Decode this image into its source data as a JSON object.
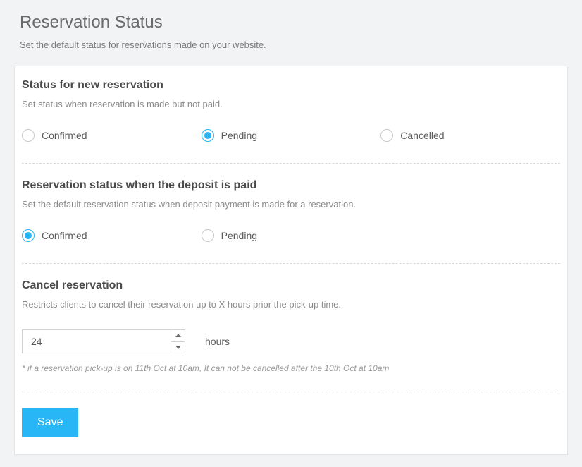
{
  "header": {
    "title": "Reservation Status",
    "subtitle": "Set the default status for reservations made on your website."
  },
  "section1": {
    "title": "Status for new reservation",
    "desc": "Set status when reservation is made but not paid.",
    "options": {
      "confirmed": "Confirmed",
      "pending": "Pending",
      "cancelled": "Cancelled"
    }
  },
  "section2": {
    "title": "Reservation status when the deposit is paid",
    "desc": "Set the default reservation status when deposit payment is made for a reservation.",
    "options": {
      "confirmed": "Confirmed",
      "pending": "Pending"
    }
  },
  "section3": {
    "title": "Cancel reservation",
    "desc": "Restricts clients to cancel their reservation up to X hours prior the pick-up time.",
    "value": "24",
    "unit": "hours",
    "note": "* if a reservation pick-up is on 11th Oct at 10am, It can not be cancelled after the 10th Oct at 10am"
  },
  "actions": {
    "save": "Save"
  }
}
